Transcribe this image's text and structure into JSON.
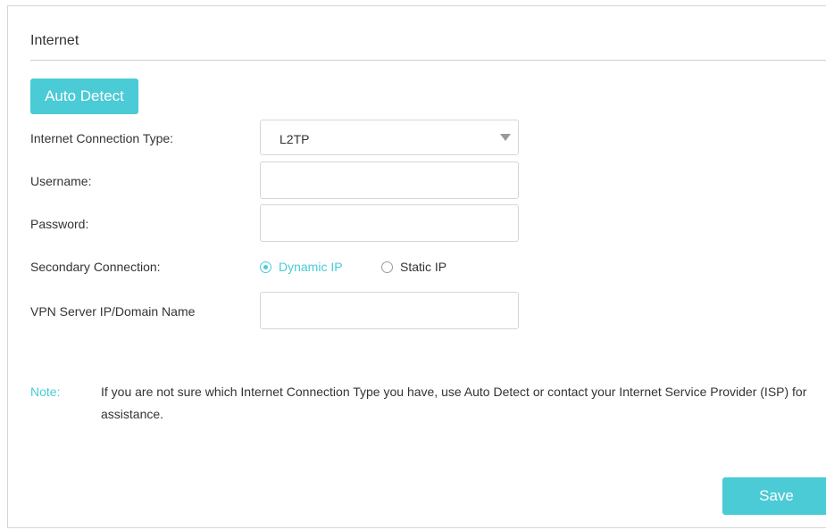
{
  "section": {
    "title": "Internet"
  },
  "auto_detect_label": "Auto Detect",
  "form": {
    "connection_type": {
      "label": "Internet Connection Type:",
      "selected": "L2TP"
    },
    "username": {
      "label": "Username:",
      "value": ""
    },
    "password": {
      "label": "Password:",
      "value": ""
    },
    "secondary_connection": {
      "label": "Secondary Connection:",
      "options": [
        {
          "label": "Dynamic IP",
          "checked": true
        },
        {
          "label": "Static IP",
          "checked": false
        }
      ]
    },
    "vpn_server": {
      "label": "VPN Server IP/Domain Name",
      "value": ""
    }
  },
  "note": {
    "label": "Note:",
    "text": "If you are not sure which Internet Connection Type you have, use Auto Detect or contact your Internet Service Provider (ISP) for assistance."
  },
  "save_label": "Save",
  "colors": {
    "accent": "#4acbd6",
    "text": "#333333",
    "border": "#d6d6d6"
  }
}
